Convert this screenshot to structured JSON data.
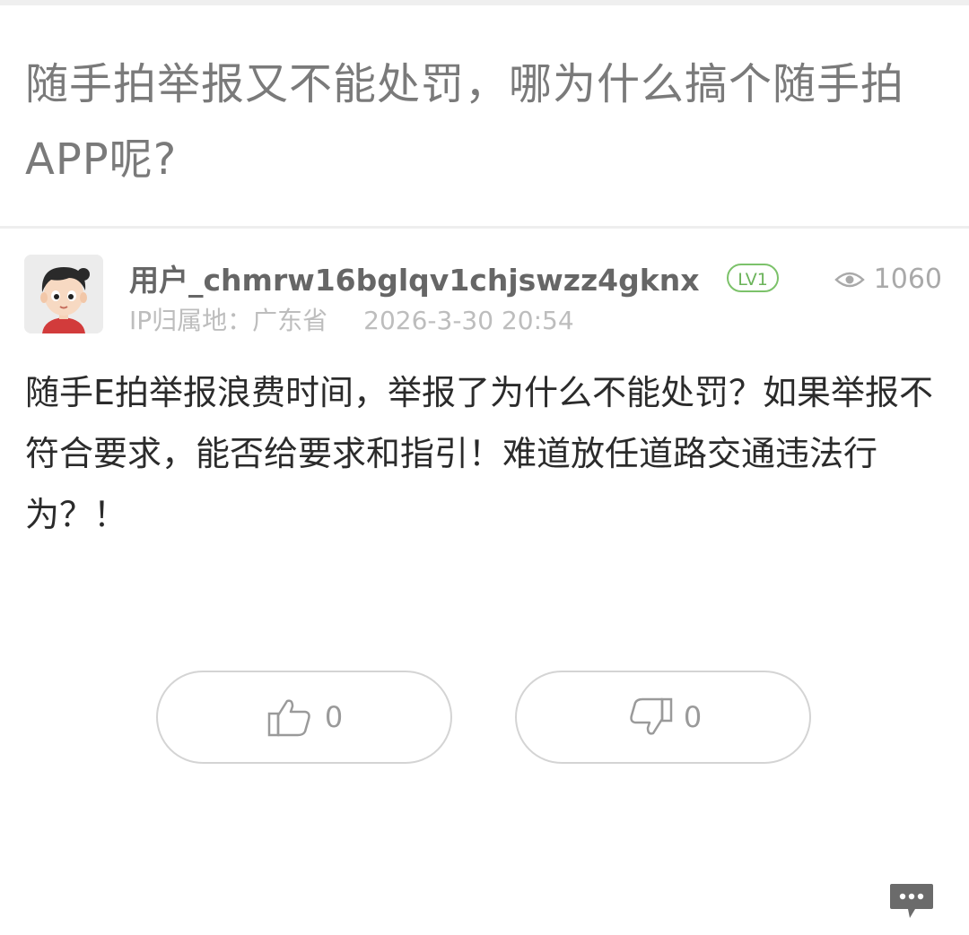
{
  "question": {
    "title": "随手拍举报又不能处罚，哪为什么搞个随手拍APP呢?"
  },
  "answer": {
    "username": "用户_chmrw16bglqv1chjswzz4gknx",
    "level": "LV1",
    "views": "1060",
    "ip_location": "IP归属地：广东省",
    "timestamp": "2026-3-30 20:54",
    "content": "随手E拍举报浪费时间，举报了为什么不能处罚？如果举报不符合要求，能否给要求和指引！难道放任道路交通违法行为？！",
    "likes": "0",
    "dislikes": "0"
  },
  "icons": {
    "avatar": "avatar-cartoon-boy",
    "views": "eye-icon",
    "like": "thumbs-up-icon",
    "dislike": "thumbs-down-icon",
    "comment": "comment-bubble-icon"
  },
  "colors": {
    "title": "#7a7a7a",
    "level_badge": "#7cc26a",
    "body_text": "#2b2b2b",
    "muted": "#bdbdbd"
  }
}
